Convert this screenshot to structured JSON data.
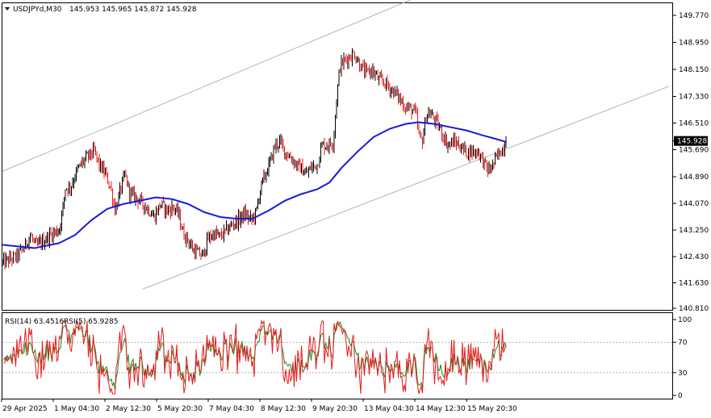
{
  "header": {
    "symbol_label": "USDJPYd,M30",
    "ohlc": "145.953 145.965 145.872 145.928",
    "menu_icon": "triangle-down-icon"
  },
  "rsi_header": {
    "rsi14_label": "RSI(14) 63.4516",
    "rsi5_label": "RSI(5) 65.9285"
  },
  "price_tag": "145.928",
  "colors": {
    "bull": "#000000",
    "bear": "#e8191b",
    "ma": "#1a1ad6",
    "channel": "#a8b8c8",
    "rsi14": "#1f8a1f",
    "rsi5": "#e8191b",
    "grid_level": "#b0b0b0",
    "axis": "#000000"
  },
  "chart_data": [
    {
      "type": "candlestick",
      "title": "USDJPYd,M30",
      "ylim": [
        140.81,
        150.2
      ],
      "y_ticks": [
        "149.770",
        "148.950",
        "148.150",
        "147.330",
        "146.510",
        "145.690",
        "144.890",
        "144.070",
        "143.250",
        "142.430",
        "141.630",
        "140.810"
      ],
      "x_ticks": [
        "29 Apr 2025",
        "1 May 04:30",
        "2 May 12:30",
        "5 May 20:30",
        "7 May 04:30",
        "8 May 12:30",
        "9 May 20:30",
        "13 May 04:30",
        "14 May 12:30",
        "15 May 20:30"
      ],
      "price_path": [
        [
          0,
          142.2
        ],
        [
          18,
          142.4
        ],
        [
          28,
          142.7
        ],
        [
          34,
          143.05
        ],
        [
          42,
          142.7
        ],
        [
          52,
          142.9
        ],
        [
          62,
          143.1
        ],
        [
          70,
          143.2
        ],
        [
          74,
          143.7
        ],
        [
          78,
          144.5
        ],
        [
          84,
          144.5
        ],
        [
          92,
          145.0
        ],
        [
          100,
          145.3
        ],
        [
          108,
          145.5
        ],
        [
          114,
          145.6
        ],
        [
          120,
          145.2
        ],
        [
          128,
          144.9
        ],
        [
          134,
          144.5
        ],
        [
          140,
          143.8
        ],
        [
          146,
          144.4
        ],
        [
          152,
          144.9
        ],
        [
          158,
          144.3
        ],
        [
          166,
          144.2
        ],
        [
          174,
          144.0
        ],
        [
          182,
          143.8
        ],
        [
          188,
          143.6
        ],
        [
          196,
          144.0
        ],
        [
          204,
          143.8
        ],
        [
          212,
          143.9
        ],
        [
          218,
          143.7
        ],
        [
          224,
          143.1
        ],
        [
          230,
          142.9
        ],
        [
          236,
          142.6
        ],
        [
          242,
          142.5
        ],
        [
          248,
          142.4
        ],
        [
          254,
          142.9
        ],
        [
          262,
          143.1
        ],
        [
          270,
          143.0
        ],
        [
          278,
          143.2
        ],
        [
          286,
          143.4
        ],
        [
          292,
          143.5
        ],
        [
          300,
          143.7
        ],
        [
          308,
          143.5
        ],
        [
          314,
          143.7
        ],
        [
          320,
          144.5
        ],
        [
          326,
          144.9
        ],
        [
          332,
          145.3
        ],
        [
          338,
          145.8
        ],
        [
          344,
          145.9
        ],
        [
          350,
          145.6
        ],
        [
          358,
          145.4
        ],
        [
          364,
          145.2
        ],
        [
          370,
          145.1
        ],
        [
          376,
          144.9
        ],
        [
          382,
          145.1
        ],
        [
          390,
          145.2
        ],
        [
          396,
          145.8
        ],
        [
          404,
          145.8
        ],
        [
          410,
          145.9
        ],
        [
          414,
          147.2
        ],
        [
          418,
          148.2
        ],
        [
          424,
          148.4
        ],
        [
          430,
          148.5
        ],
        [
          436,
          148.6
        ],
        [
          442,
          148.3
        ],
        [
          450,
          148.0
        ],
        [
          458,
          148.1
        ],
        [
          466,
          147.8
        ],
        [
          474,
          147.7
        ],
        [
          482,
          147.5
        ],
        [
          490,
          147.3
        ],
        [
          498,
          147.0
        ],
        [
          506,
          146.9
        ],
        [
          512,
          146.8
        ],
        [
          516,
          146.1
        ],
        [
          520,
          145.9
        ],
        [
          526,
          146.8
        ],
        [
          532,
          146.7
        ],
        [
          540,
          146.4
        ],
        [
          546,
          146.1
        ],
        [
          552,
          145.8
        ],
        [
          560,
          145.9
        ],
        [
          566,
          145.8
        ],
        [
          574,
          145.6
        ],
        [
          582,
          145.6
        ],
        [
          590,
          145.6
        ],
        [
          596,
          145.3
        ],
        [
          602,
          145.0
        ],
        [
          608,
          145.2
        ],
        [
          614,
          145.5
        ],
        [
          620,
          145.7
        ],
        [
          624,
          145.93
        ]
      ],
      "moving_average": [
        [
          0,
          142.75
        ],
        [
          40,
          142.65
        ],
        [
          70,
          142.8
        ],
        [
          90,
          143.05
        ],
        [
          110,
          143.5
        ],
        [
          130,
          143.85
        ],
        [
          150,
          144.0
        ],
        [
          170,
          144.1
        ],
        [
          190,
          144.2
        ],
        [
          210,
          144.15
        ],
        [
          230,
          144.0
        ],
        [
          250,
          143.75
        ],
        [
          270,
          143.6
        ],
        [
          290,
          143.55
        ],
        [
          310,
          143.55
        ],
        [
          330,
          143.8
        ],
        [
          350,
          144.1
        ],
        [
          370,
          144.3
        ],
        [
          390,
          144.45
        ],
        [
          405,
          144.65
        ],
        [
          420,
          145.1
        ],
        [
          440,
          145.6
        ],
        [
          460,
          146.05
        ],
        [
          480,
          146.3
        ],
        [
          500,
          146.45
        ],
        [
          515,
          146.5
        ],
        [
          535,
          146.45
        ],
        [
          555,
          146.35
        ],
        [
          575,
          146.25
        ],
        [
          595,
          146.1
        ],
        [
          610,
          146.0
        ],
        [
          624,
          145.9
        ]
      ],
      "channel_lines": [
        [
          [
            0,
            145.0
          ],
          [
            540,
            150.6
          ]
        ],
        [
          [
            174,
            141.4
          ],
          [
            826,
            147.6
          ]
        ]
      ],
      "current_price": 145.928
    },
    {
      "type": "line",
      "title": "RSI(14) 63.4516 RSI(5) 65.9285",
      "ylim": [
        0,
        100
      ],
      "y_ticks": [
        "100",
        "70",
        "30",
        "0"
      ],
      "levels": [
        70,
        30
      ],
      "series": [
        {
          "name": "RSI(14)",
          "last": 63.4516
        },
        {
          "name": "RSI(5)",
          "last": 65.9285
        }
      ]
    }
  ]
}
